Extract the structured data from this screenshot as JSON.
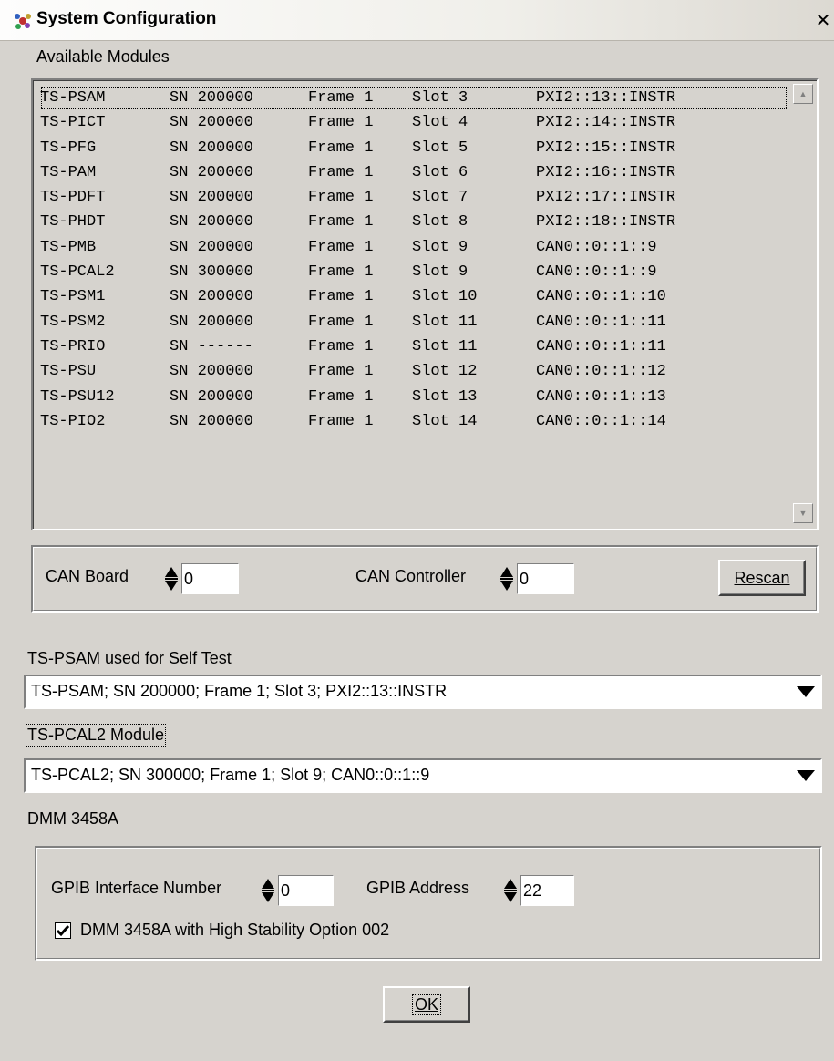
{
  "window": {
    "title": "System Configuration",
    "close_label": "✕"
  },
  "available_modules": {
    "label": "Available Modules",
    "rows": [
      [
        "TS-PSAM",
        "SN 200000",
        "Frame 1",
        "Slot 3",
        "PXI2::13::INSTR"
      ],
      [
        "TS-PICT",
        "SN 200000",
        "Frame 1",
        "Slot 4",
        "PXI2::14::INSTR"
      ],
      [
        "TS-PFG",
        "SN 200000",
        "Frame 1",
        "Slot 5",
        "PXI2::15::INSTR"
      ],
      [
        "TS-PAM",
        "SN 200000",
        "Frame 1",
        "Slot 6",
        "PXI2::16::INSTR"
      ],
      [
        "TS-PDFT",
        "SN 200000",
        "Frame 1",
        "Slot 7",
        "PXI2::17::INSTR"
      ],
      [
        "TS-PHDT",
        "SN 200000",
        "Frame 1",
        "Slot 8",
        "PXI2::18::INSTR"
      ],
      [
        "TS-PMB",
        "SN 200000",
        "Frame 1",
        "Slot 9",
        "CAN0::0::1::9"
      ],
      [
        "TS-PCAL2",
        "SN 300000",
        "Frame 1",
        "Slot 9",
        "CAN0::0::1::9"
      ],
      [
        "TS-PSM1",
        "SN 200000",
        "Frame 1",
        "Slot 10",
        "CAN0::0::1::10"
      ],
      [
        "TS-PSM2",
        "SN 200000",
        "Frame 1",
        "Slot 11",
        "CAN0::0::1::11"
      ],
      [
        "TS-PRIO",
        "SN ------",
        "Frame 1",
        "Slot 11",
        "CAN0::0::1::11"
      ],
      [
        "TS-PSU",
        "SN 200000",
        "Frame 1",
        "Slot 12",
        "CAN0::0::1::12"
      ],
      [
        "TS-PSU12",
        "SN 200000",
        "Frame 1",
        "Slot 13",
        "CAN0::0::1::13"
      ],
      [
        "TS-PIO2",
        "SN 200000",
        "Frame 1",
        "Slot 14",
        "CAN0::0::1::14"
      ]
    ]
  },
  "can": {
    "board_label": "CAN Board",
    "board_value": "0",
    "controller_label": "CAN Controller",
    "controller_value": "0",
    "rescan_label": "Rescan"
  },
  "self_test": {
    "label": "TS-PSAM used for Self Test",
    "value": "TS-PSAM; SN 200000; Frame 1; Slot 3; PXI2::13::INSTR"
  },
  "pcal2": {
    "label": "TS-PCAL2 Module",
    "value": "TS-PCAL2; SN 300000; Frame 1; Slot 9; CAN0::0::1::9"
  },
  "dmm": {
    "label": "DMM 3458A",
    "gpib_interface_label": "GPIB Interface Number",
    "gpib_interface_value": "0",
    "gpib_address_label": "GPIB Address",
    "gpib_address_value": "22",
    "high_stability_label": "DMM 3458A with High Stability Option 002",
    "high_stability_checked": true
  },
  "ok_label": "OK"
}
